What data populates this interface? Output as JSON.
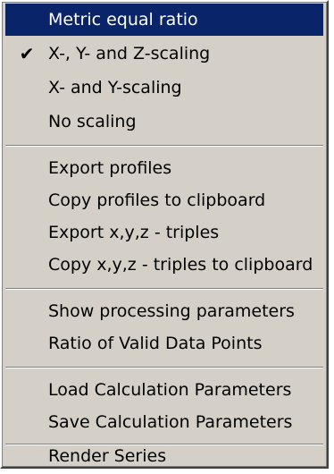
{
  "menu": {
    "groups": [
      [
        {
          "label": "Metric equal ratio",
          "checked": false,
          "highlighted": true
        },
        {
          "label": "X-, Y- and Z-scaling",
          "checked": true,
          "highlighted": false
        },
        {
          "label": "X- and  Y-scaling",
          "checked": false,
          "highlighted": false
        },
        {
          "label": "No scaling",
          "checked": false,
          "highlighted": false
        }
      ],
      [
        {
          "label": "Export profiles"
        },
        {
          "label": "Copy profiles to clipboard"
        },
        {
          "label": "Export x,y,z - triples"
        },
        {
          "label": "Copy x,y,z - triples to clipboard"
        }
      ],
      [
        {
          "label": "Show processing parameters"
        },
        {
          "label": "Ratio of Valid Data Points"
        }
      ],
      [
        {
          "label": "Load Calculation Parameters"
        },
        {
          "label": "Save Calculation Parameters"
        }
      ],
      [
        {
          "label": "Render Series"
        }
      ]
    ],
    "check_glyph": "✔"
  },
  "colors": {
    "menu_background": "#d4d0c8",
    "highlight_background": "#0a246a",
    "highlight_text": "#ffffff"
  }
}
